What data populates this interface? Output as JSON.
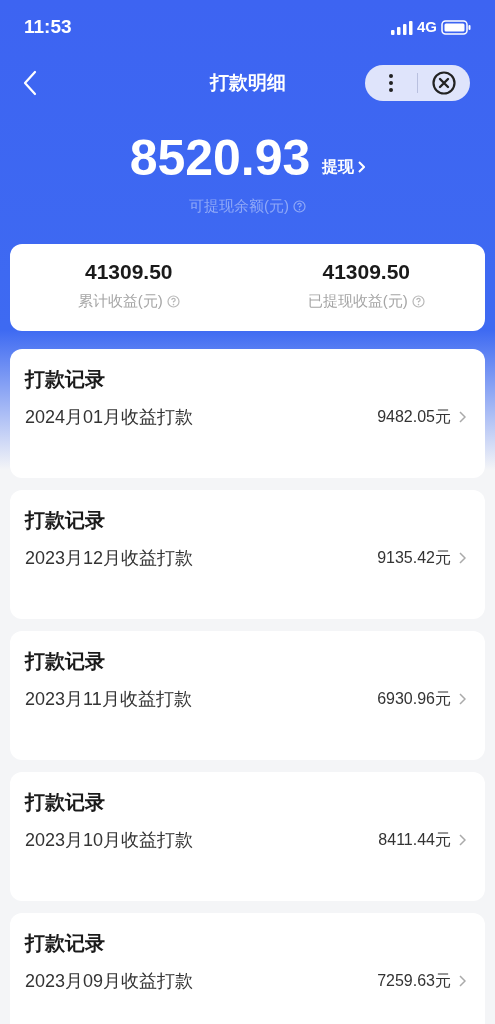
{
  "status_bar": {
    "time": "11:53",
    "network": "4G"
  },
  "nav": {
    "title": "打款明细"
  },
  "balance": {
    "amount": "8520.93",
    "action": "提现",
    "caption": "可提现余额(元)"
  },
  "stats": [
    {
      "value": "41309.50",
      "label": "累计收益(元)"
    },
    {
      "value": "41309.50",
      "label": "已提现收益(元)"
    }
  ],
  "records": [
    {
      "title": "打款记录",
      "period": "2024月01月收益打款",
      "amount": "9482.05元"
    },
    {
      "title": "打款记录",
      "period": "2023月12月收益打款",
      "amount": "9135.42元"
    },
    {
      "title": "打款记录",
      "period": "2023月11月收益打款",
      "amount": "6930.96元"
    },
    {
      "title": "打款记录",
      "period": "2023月10月收益打款",
      "amount": "8411.44元"
    },
    {
      "title": "打款记录",
      "period": "2023月09月收益打款",
      "amount": "7259.63元"
    }
  ]
}
